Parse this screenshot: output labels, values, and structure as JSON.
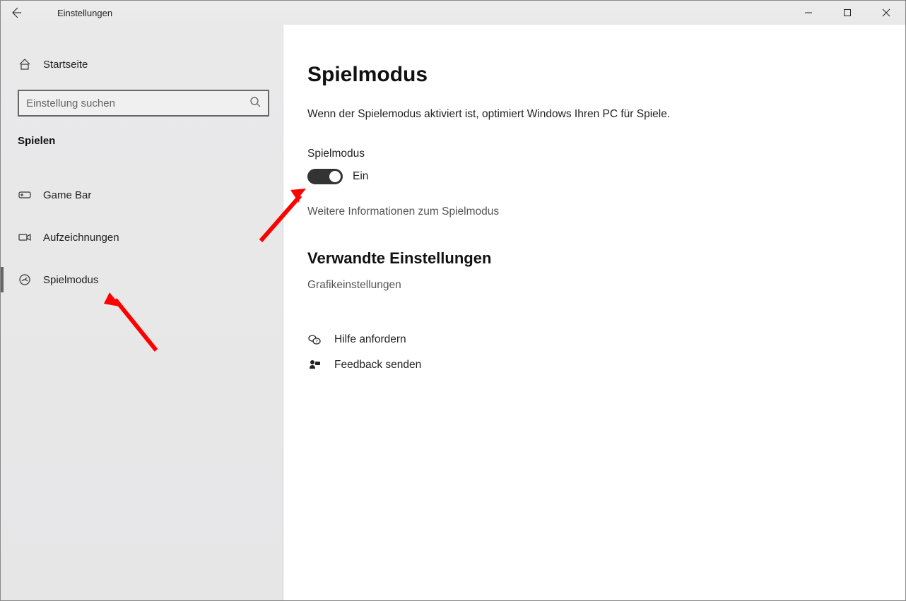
{
  "titlebar": {
    "title": "Einstellungen"
  },
  "sidebar": {
    "home_label": "Startseite",
    "search_placeholder": "Einstellung suchen",
    "category": "Spielen",
    "items": [
      {
        "label": "Game Bar",
        "icon": "gamebar-icon",
        "selected": false
      },
      {
        "label": "Aufzeichnungen",
        "icon": "recordings-icon",
        "selected": false
      },
      {
        "label": "Spielmodus",
        "icon": "gamemode-icon",
        "selected": true
      }
    ]
  },
  "main": {
    "page_title": "Spielmodus",
    "description": "Wenn der Spielemodus aktiviert ist, optimiert Windows Ihren PC für Spiele.",
    "toggle_label": "Spielmodus",
    "toggle_state_label": "Ein",
    "toggle_on": true,
    "more_info_link": "Weitere Informationen zum Spielmodus",
    "related_heading": "Verwandte Einstellungen",
    "related_link": "Grafikeinstellungen",
    "help_label": "Hilfe anfordern",
    "feedback_label": "Feedback senden"
  }
}
